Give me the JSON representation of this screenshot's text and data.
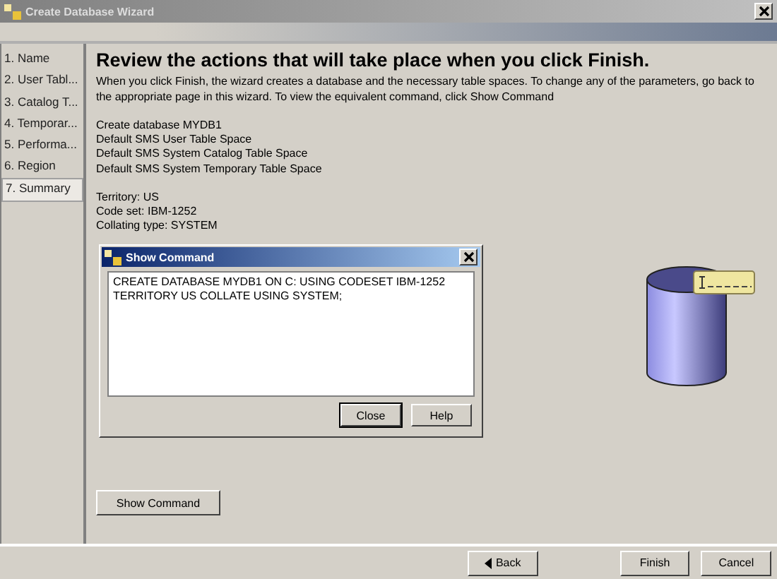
{
  "window": {
    "title": "Create Database Wizard"
  },
  "steps": [
    {
      "label": "1. Name",
      "selected": false
    },
    {
      "label": "2. User Tabl...",
      "selected": false
    },
    {
      "label": "3. Catalog T...",
      "selected": false
    },
    {
      "label": "4. Temporar...",
      "selected": false
    },
    {
      "label": "5. Performa...",
      "selected": false
    },
    {
      "label": "6. Region",
      "selected": false
    },
    {
      "label": "7. Summary",
      "selected": true
    }
  ],
  "heading": "Review the actions that will take place when you click Finish.",
  "intro": "When you click Finish, the wizard creates a database and the necessary table spaces. To change any of the parameters, go back to the appropriate page in this wizard. To view the equivalent command, click Show Command",
  "actions": [
    "Create database MYDB1",
    "Default SMS User Table Space",
    "Default SMS System Catalog Table Space",
    "Default SMS System Temporary Table Space"
  ],
  "settings": [
    "Territory: US",
    "Code set: IBM-1252",
    "Collating type: SYSTEM"
  ],
  "dialog": {
    "title": "Show Command",
    "command": "CREATE DATABASE MYDB1 ON C: USING CODESET IBM-1252 TERRITORY US COLLATE USING SYSTEM;",
    "buttons": [
      "Close",
      "Help"
    ]
  },
  "show_command_button": "Show Command",
  "footer_buttons": [
    "Back",
    "Finish",
    "Cancel"
  ]
}
